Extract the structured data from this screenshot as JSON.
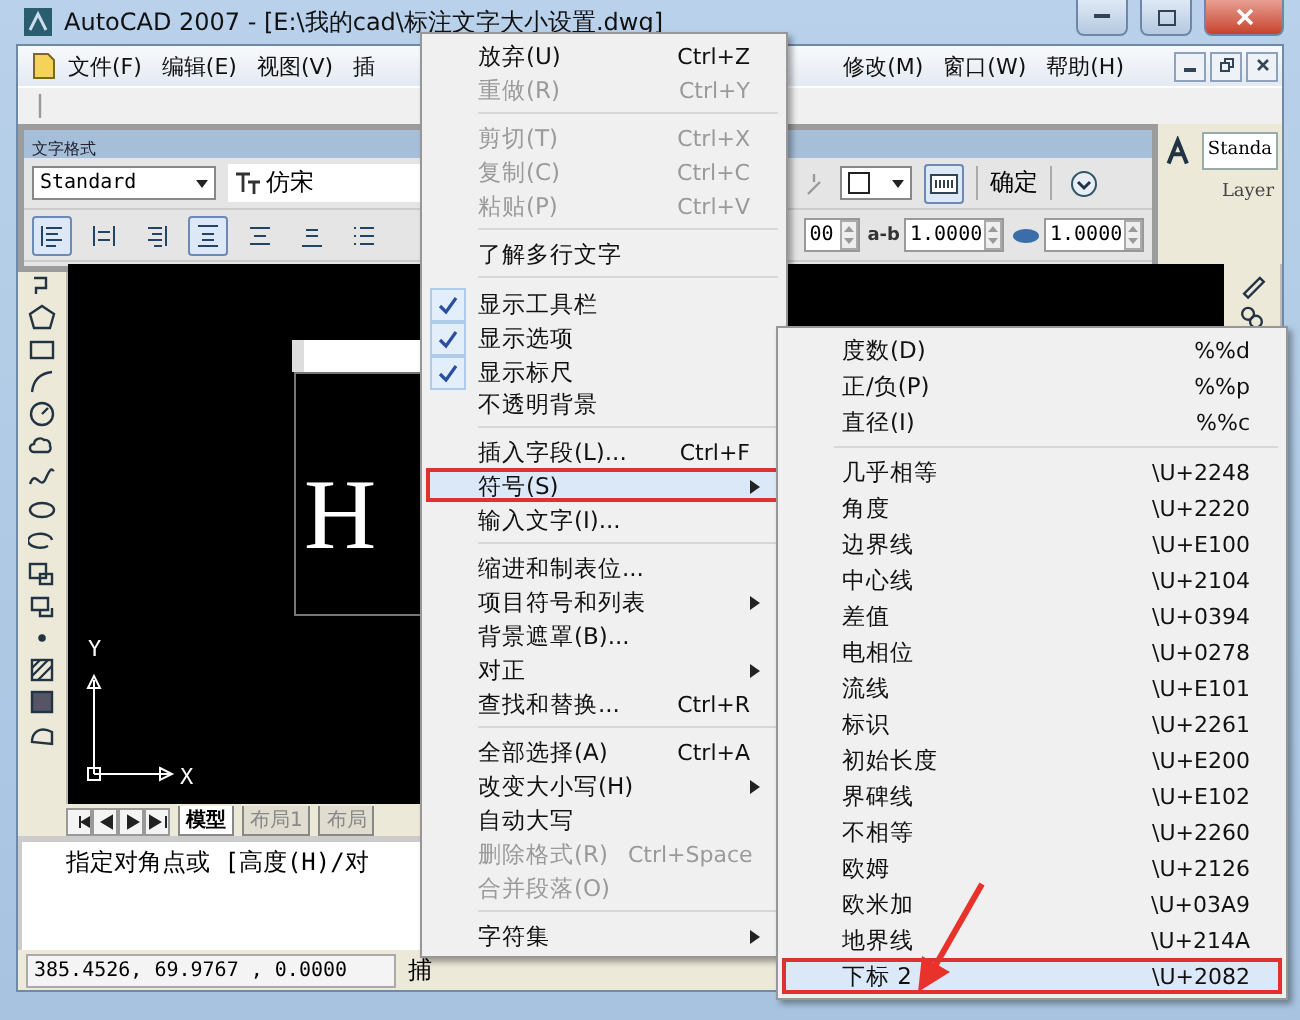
{
  "window": {
    "title": "AutoCAD 2007 - [E:\\我的cad\\标注文字大小设置.dwg]"
  },
  "menu_bar": {
    "left": [
      "文件(F)",
      "编辑(E)",
      "视图(V)",
      "插"
    ],
    "right": [
      "修改(M)",
      "窗口(W)",
      "帮助(H)"
    ]
  },
  "text_format_toolbar": {
    "title": "文字格式",
    "style": "Standard",
    "font": "仿宋",
    "confirm": "确定",
    "spinners": [
      {
        "value": "00"
      },
      {
        "label": "a-b",
        "value": "1.0000"
      },
      {
        "value": "1.0000"
      }
    ]
  },
  "properties_bar": {
    "style": "Standa",
    "layer": "Layer"
  },
  "canvas": {
    "text": "H",
    "axis_x": "X",
    "axis_y": "Y"
  },
  "layout_tabs": [
    {
      "label": "模型",
      "selected": true
    },
    {
      "label": "布局1",
      "selected": false
    },
    {
      "label": "布局",
      "selected": false
    }
  ],
  "command_line": "指定对角点或 [高度(H)/对",
  "status_bar": {
    "coordinates": "385.4526, 69.9767 , 0.0000",
    "button": "捕"
  },
  "context_menu": {
    "items": [
      {
        "kind": "command",
        "label": "放弃(U)",
        "shortcut": "Ctrl+Z",
        "disabled": false,
        "selected": false
      },
      {
        "kind": "command",
        "label": "重做(R)",
        "shortcut": "Ctrl+Y",
        "disabled": true,
        "selected": false
      },
      {
        "kind": "separator"
      },
      {
        "kind": "command",
        "label": "剪切(T)",
        "shortcut": "Ctrl+X",
        "disabled": true,
        "selected": false
      },
      {
        "kind": "command",
        "label": "复制(C)",
        "shortcut": "Ctrl+C",
        "disabled": true,
        "selected": false
      },
      {
        "kind": "command",
        "label": "粘贴(P)",
        "shortcut": "Ctrl+V",
        "disabled": true,
        "selected": false
      },
      {
        "kind": "separator"
      },
      {
        "kind": "command",
        "label": "了解多行文字",
        "disabled": false,
        "selected": false
      },
      {
        "kind": "separator"
      },
      {
        "kind": "toggle",
        "label": "显示工具栏",
        "checked": true,
        "disabled": false,
        "selected": false
      },
      {
        "kind": "toggle",
        "label": "显示选项",
        "checked": true,
        "disabled": false,
        "selected": false
      },
      {
        "kind": "toggle",
        "label": "显示标尺",
        "checked": true,
        "disabled": false,
        "selected": false
      },
      {
        "kind": "toggle",
        "label": "不透明背景",
        "checked": false,
        "disabled": false,
        "selected": false
      },
      {
        "kind": "separator"
      },
      {
        "kind": "command",
        "label": "插入字段(L)...",
        "shortcut": "Ctrl+F",
        "disabled": false,
        "selected": false
      },
      {
        "kind": "submenu",
        "label": "符号(S)",
        "disabled": false,
        "selected": true
      },
      {
        "kind": "command",
        "label": "输入文字(I)...",
        "disabled": false,
        "selected": false
      },
      {
        "kind": "separator"
      },
      {
        "kind": "command",
        "label": "缩进和制表位...",
        "disabled": false,
        "selected": false
      },
      {
        "kind": "submenu",
        "label": "项目符号和列表",
        "disabled": false,
        "selected": false
      },
      {
        "kind": "command",
        "label": "背景遮罩(B)...",
        "disabled": false,
        "selected": false
      },
      {
        "kind": "submenu",
        "label": "对正",
        "disabled": false,
        "selected": false
      },
      {
        "kind": "command",
        "label": "查找和替换...",
        "shortcut": "Ctrl+R",
        "disabled": false,
        "selected": false
      },
      {
        "kind": "separator"
      },
      {
        "kind": "command",
        "label": "全部选择(A)",
        "shortcut": "Ctrl+A",
        "disabled": false,
        "selected": false
      },
      {
        "kind": "submenu",
        "label": "改变大小写(H)",
        "disabled": false,
        "selected": false
      },
      {
        "kind": "command",
        "label": "自动大写",
        "disabled": false,
        "selected": false
      },
      {
        "kind": "command",
        "label": "删除格式(R)",
        "shortcut": "Ctrl+Space",
        "disabled": true,
        "selected": false
      },
      {
        "kind": "command",
        "label": "合并段落(O)",
        "disabled": true,
        "selected": false
      },
      {
        "kind": "separator"
      },
      {
        "kind": "submenu",
        "label": "字符集",
        "disabled": false,
        "selected": false
      }
    ]
  },
  "symbol_submenu": {
    "items": [
      {
        "kind": "item",
        "label": "度数(D)",
        "code": "%%d",
        "selected": false
      },
      {
        "kind": "item",
        "label": "正/负(P)",
        "code": "%%p",
        "selected": false
      },
      {
        "kind": "item",
        "label": "直径(I)",
        "code": "%%c",
        "selected": false
      },
      {
        "kind": "separator"
      },
      {
        "kind": "item",
        "label": "几乎相等",
        "code": "\\U+2248",
        "selected": false
      },
      {
        "kind": "item",
        "label": "角度",
        "code": "\\U+2220",
        "selected": false
      },
      {
        "kind": "item",
        "label": "边界线",
        "code": "\\U+E100",
        "selected": false
      },
      {
        "kind": "item",
        "label": "中心线",
        "code": "\\U+2104",
        "selected": false
      },
      {
        "kind": "item",
        "label": "差值",
        "code": "\\U+0394",
        "selected": false
      },
      {
        "kind": "item",
        "label": "电相位",
        "code": "\\U+0278",
        "selected": false
      },
      {
        "kind": "item",
        "label": "流线",
        "code": "\\U+E101",
        "selected": false
      },
      {
        "kind": "item",
        "label": "标识",
        "code": "\\U+2261",
        "selected": false
      },
      {
        "kind": "item",
        "label": "初始长度",
        "code": "\\U+E200",
        "selected": false
      },
      {
        "kind": "item",
        "label": "界碑线",
        "code": "\\U+E102",
        "selected": false
      },
      {
        "kind": "item",
        "label": "不相等",
        "code": "\\U+2260",
        "selected": false
      },
      {
        "kind": "item",
        "label": "欧姆",
        "code": "\\U+2126",
        "selected": false
      },
      {
        "kind": "item",
        "label": "欧米加",
        "code": "\\U+03A9",
        "selected": false
      },
      {
        "kind": "item",
        "label": "地界线",
        "code": "\\U+214A",
        "selected": false
      },
      {
        "kind": "item",
        "label": "下标 2",
        "code": "\\U+2082",
        "selected": true
      }
    ]
  }
}
